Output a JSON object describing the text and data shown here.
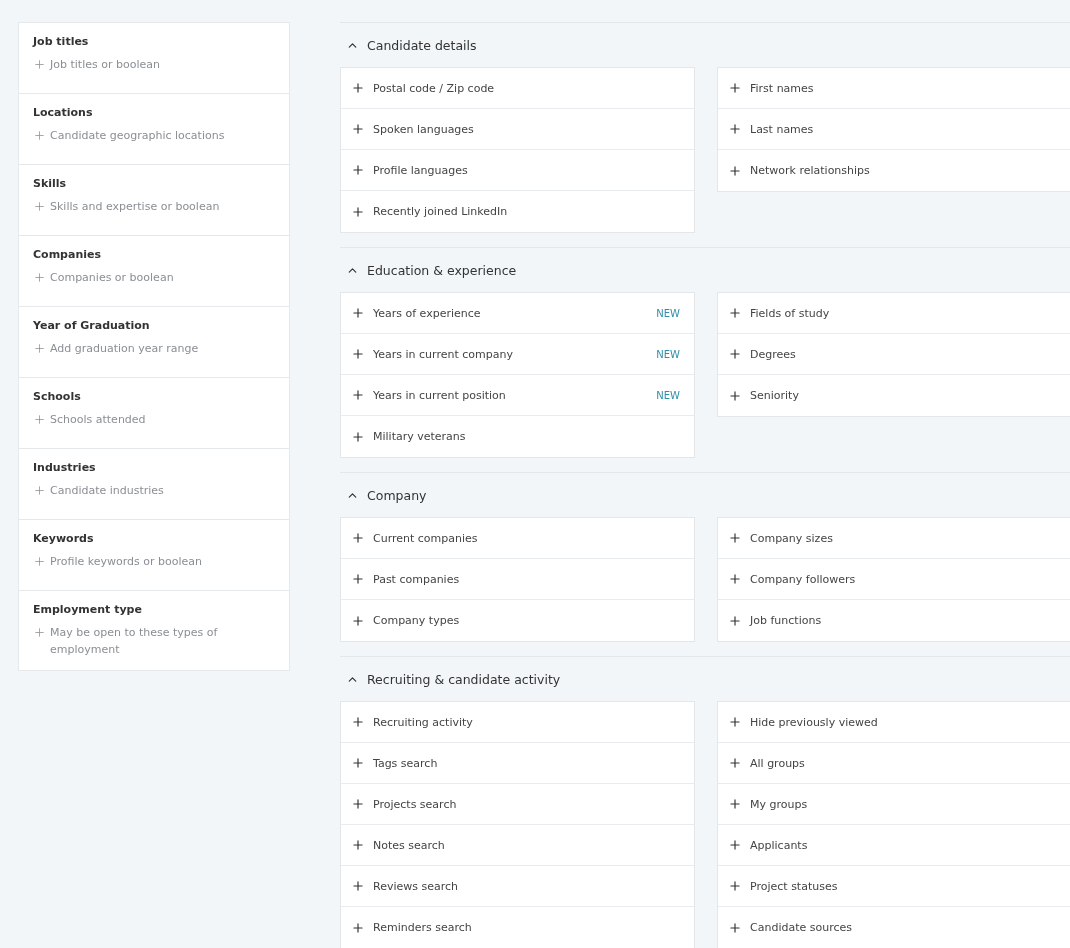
{
  "filters": [
    {
      "title": "Job titles",
      "action": "Job titles or boolean"
    },
    {
      "title": "Locations",
      "action": "Candidate geographic locations"
    },
    {
      "title": "Skills",
      "action": "Skills and expertise or boolean"
    },
    {
      "title": "Companies",
      "action": "Companies or boolean"
    },
    {
      "title": "Year of Graduation",
      "action": "Add graduation year range"
    },
    {
      "title": "Schools",
      "action": "Schools attended"
    },
    {
      "title": "Industries",
      "action": "Candidate industries"
    },
    {
      "title": "Keywords",
      "action": "Profile keywords or boolean"
    },
    {
      "title": "Employment type",
      "action": "May be open to these types of employment"
    }
  ],
  "sections": [
    {
      "title": "Candidate details",
      "expanded": true,
      "columns": [
        [
          {
            "label": "Postal code / Zip code"
          },
          {
            "label": "Spoken languages"
          },
          {
            "label": "Profile languages"
          },
          {
            "label": "Recently joined LinkedIn"
          }
        ],
        [
          {
            "label": "First names"
          },
          {
            "label": "Last names"
          },
          {
            "label": "Network relationships"
          }
        ]
      ]
    },
    {
      "title": "Education & experience",
      "expanded": true,
      "columns": [
        [
          {
            "label": "Years of experience",
            "badge": "NEW"
          },
          {
            "label": "Years in current company",
            "badge": "NEW"
          },
          {
            "label": "Years in current position",
            "badge": "NEW"
          },
          {
            "label": "Military veterans"
          }
        ],
        [
          {
            "label": "Fields of study"
          },
          {
            "label": "Degrees"
          },
          {
            "label": "Seniority"
          }
        ]
      ]
    },
    {
      "title": "Company",
      "expanded": true,
      "columns": [
        [
          {
            "label": "Current companies"
          },
          {
            "label": "Past companies"
          },
          {
            "label": "Company types"
          }
        ],
        [
          {
            "label": "Company sizes"
          },
          {
            "label": "Company followers"
          },
          {
            "label": "Job functions"
          }
        ]
      ]
    },
    {
      "title": "Recruiting & candidate activity",
      "expanded": true,
      "columns": [
        [
          {
            "label": "Recruiting activity"
          },
          {
            "label": "Tags search"
          },
          {
            "label": "Projects search"
          },
          {
            "label": "Notes search"
          },
          {
            "label": "Reviews search"
          },
          {
            "label": "Reminders search"
          }
        ],
        [
          {
            "label": "Hide previously viewed"
          },
          {
            "label": "All groups"
          },
          {
            "label": "My groups"
          },
          {
            "label": "Applicants"
          },
          {
            "label": "Project statuses"
          },
          {
            "label": "Candidate sources"
          }
        ]
      ]
    }
  ]
}
